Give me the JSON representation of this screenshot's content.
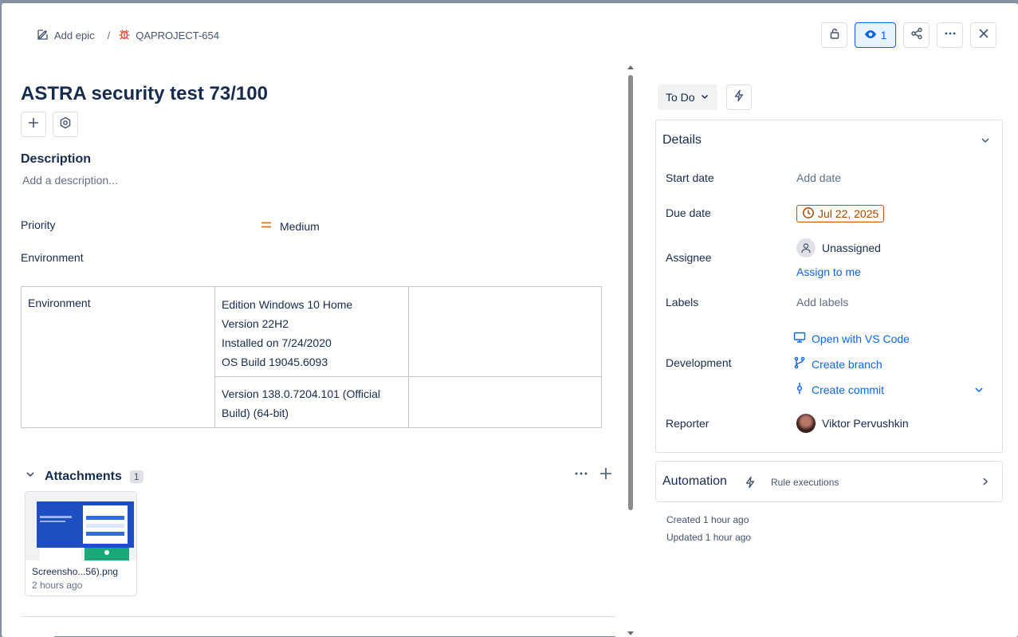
{
  "breadcrumb": {
    "epic": "Add epic",
    "separator": "/",
    "issue_key": "QAPROJECT-654"
  },
  "top_actions": {
    "watch_count": "1"
  },
  "issue": {
    "title": "ASTRA security test 73/100",
    "description_heading": "Description",
    "description_placeholder": "Add a description...",
    "priority_label": "Priority",
    "priority_value": "Medium",
    "priority_color": "#e2770d",
    "environment_label": "Environment"
  },
  "env_table": {
    "row_header": "Environment",
    "cell1": [
      "Edition Windows 10 Home",
      "Version 22H2",
      "Installed on 7/24/2020",
      "OS Build 19045.6093"
    ],
    "cell2": [
      "Version 138.0.7204.101 (Official",
      "Build) (64-bit)"
    ]
  },
  "attachments": {
    "title": "Attachments",
    "count": "1",
    "items": [
      {
        "name": "Screensho...56).png",
        "time": "2 hours ago"
      }
    ]
  },
  "status": {
    "label": "To Do"
  },
  "details": {
    "heading": "Details",
    "start_date_label": "Start date",
    "start_date_value": "Add date",
    "due_date_label": "Due date",
    "due_date_value": "Jul 22, 2025",
    "assignee_label": "Assignee",
    "assignee_value": "Unassigned",
    "assign_to_me": "Assign to me",
    "labels_label": "Labels",
    "labels_value": "Add labels",
    "development_label": "Development",
    "dev_open_vscode": "Open with VS Code",
    "dev_create_branch": "Create branch",
    "dev_create_commit": "Create commit",
    "reporter_label": "Reporter",
    "reporter_value": "Viktor Pervushkin"
  },
  "automation": {
    "title": "Automation",
    "rule_executions": "Rule executions"
  },
  "meta": {
    "created": "Created 1 hour ago",
    "updated": "Updated 1 hour ago"
  },
  "colors": {
    "link": "#0c66e4",
    "accent_bg": "#e9f2ff",
    "due_border": "#c25100"
  }
}
